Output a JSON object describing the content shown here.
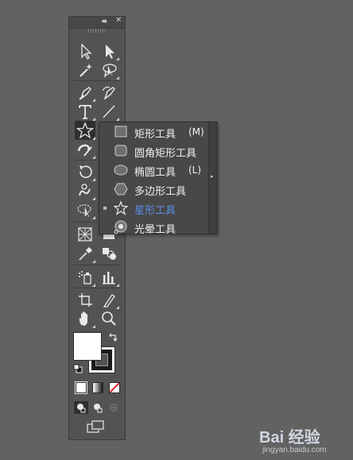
{
  "toolbar": {
    "collapse_glyph": "◂◂",
    "close_glyph": "✕"
  },
  "shape_flyout": {
    "items": [
      {
        "icon": "rectangle-tool-icon",
        "label": "矩形工具",
        "shortcut": "(M)",
        "selected": false
      },
      {
        "icon": "rounded-rectangle-tool-icon",
        "label": "圆角矩形工具",
        "shortcut": "",
        "selected": false
      },
      {
        "icon": "ellipse-tool-icon",
        "label": "椭圆工具",
        "shortcut": "(L)",
        "selected": false
      },
      {
        "icon": "polygon-tool-icon",
        "label": "多边形工具",
        "shortcut": "",
        "selected": false
      },
      {
        "icon": "star-tool-icon",
        "label": "星形工具",
        "shortcut": "",
        "selected": true
      },
      {
        "icon": "flare-tool-icon",
        "label": "光晕工具",
        "shortcut": "",
        "selected": false
      }
    ],
    "tearoff_glyph": "▸"
  },
  "colors": {
    "fill": "#ffffff",
    "stroke": "#ffffff",
    "panel_bg": "#535353",
    "selected_text": "#5b8fe8"
  },
  "watermark": {
    "brand": "Bai 经验",
    "url": "jingyan.baidu.com"
  }
}
